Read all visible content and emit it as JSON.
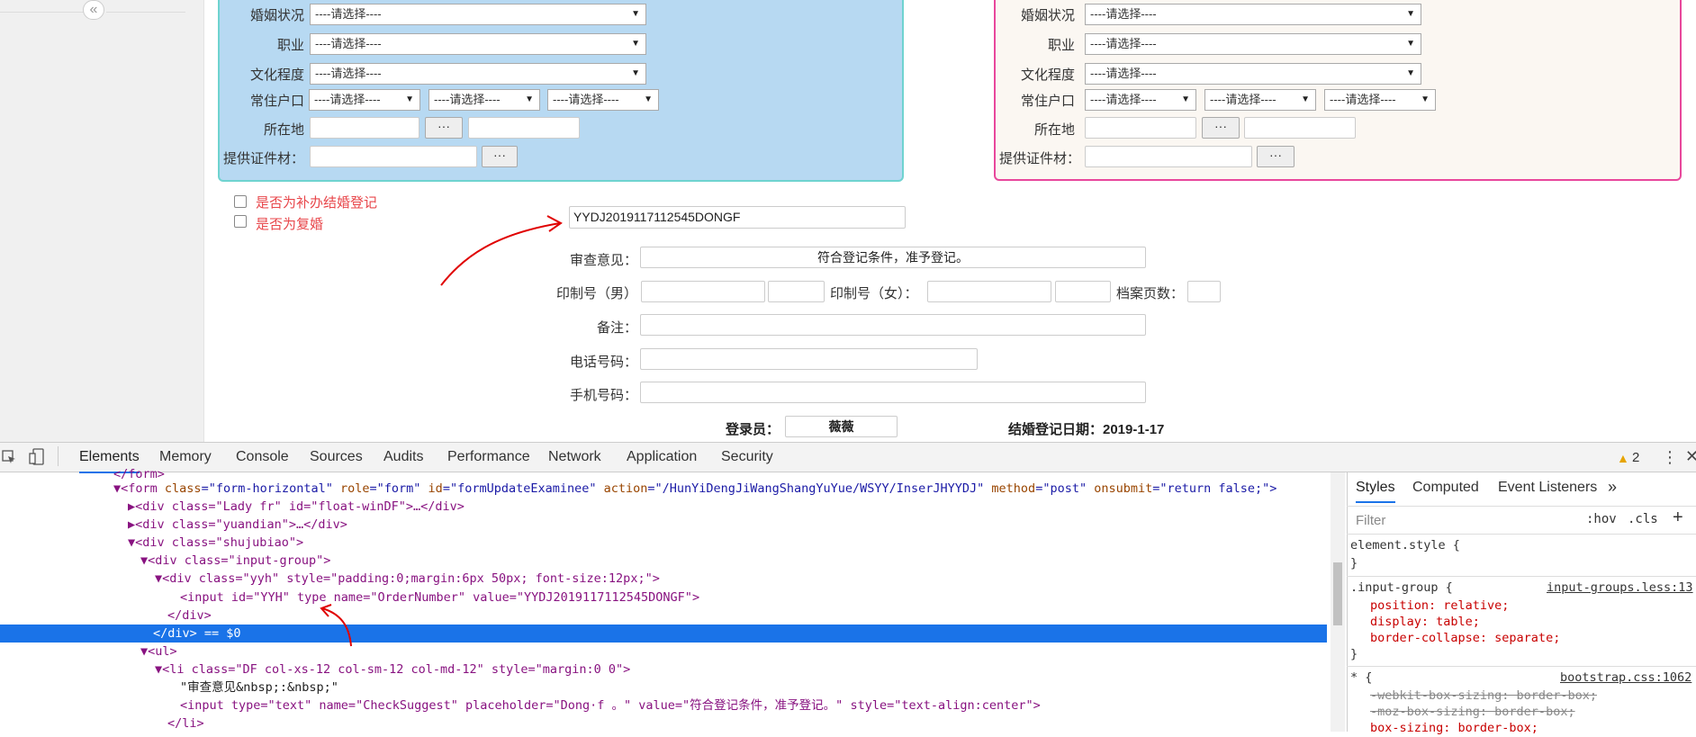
{
  "form": {
    "select_placeholder": "----请选择----",
    "labels": {
      "marital": "婚姻状况",
      "job": "职业",
      "education": "文化程度",
      "residence": "常住户口",
      "location": "所在地",
      "documents": "提供证件材：",
      "review": "审查意见：",
      "print_male": "印制号（男）",
      "print_female": "印制号（女）：",
      "archive_pages": "档案页数：",
      "notes": "备注：",
      "phone": "电话号码：",
      "mobile": "手机号码：",
      "operator": "登录员：",
      "marriage_date": "结婚登记日期：2019-1-17"
    },
    "dots": "···",
    "checkbox_supplement": "是否为补办结婚登记",
    "checkbox_remarry": "是否为复婚",
    "order_number": "YYDJ2019117112545DONGF",
    "review_value": "符合登记条件，准予登记。",
    "operator_value": "薇薇"
  },
  "devtools": {
    "tabs": [
      "Elements",
      "Memory",
      "Console",
      "Sources",
      "Audits",
      "Performance",
      "Network",
      "Application",
      "Security"
    ],
    "warning_count": "2",
    "warning_icon": "warning-icon",
    "dom_lines": {
      "l0": "</form>",
      "l1a": "<form ",
      "l1b": "class",
      "l1c": "=\"form-horizontal\" ",
      "l1d": "role",
      "l1e": "=\"form\" ",
      "l1f": "id",
      "l1g": "=\"formUpdateExaminee\" ",
      "l1h": "action",
      "l1i": "=\"/HunYiDengJiWangShangYuYue/WSYY/InserJHYYDJ\" ",
      "l1j": "method",
      "l1k": "=\"post\" ",
      "l1l": "onsubmit",
      "l1m": "=\"return false;\">",
      "l2": "<div class=\"Lady fr\" id=\"float-winDF\">…</div>",
      "l3": "<div class=\"yuandian\">…</div>",
      "l4": "<div class=\"shujubiao\">",
      "l5": "<div class=\"input-group\">",
      "l6": "<div class=\"yyh\" style=\"padding:0;margin:6px 50px; font-size:12px;\">",
      "l7": "<input id=\"YYH\" type name=\"OrderNumber\" value=\"YYDJ2019117112545DONGF\">",
      "l8": "</div>",
      "l9": "</div> == $0",
      "l10": "<ul>",
      "l11": "<li class=\"DF col-xs-12 col-sm-12 col-md-12\" style=\"margin:0 0\">",
      "l12": "\"审查意见&nbsp;:&nbsp;\"",
      "l13": "<input type=\"text\" name=\"CheckSuggest\" placeholder=\"Dong·f 。\" value=\"符合登记条件，准予登记。\" style=\"text-align:center\">",
      "l14": "</li>"
    },
    "styles": {
      "tabs": [
        "Styles",
        "Computed",
        "Event Listeners",
        "»"
      ],
      "filter_placeholder": "Filter",
      "hov": ":hov",
      "cls": ".cls",
      "plus": "+",
      "element_style": "element.style {",
      "close_brace": "}",
      "rule1_selector": ".input-group {",
      "rule1_source": "input-groups.less:13",
      "rule1_props": [
        "position: relative;",
        "display: table;",
        "border-collapse: separate;"
      ],
      "rule2_selector": "* {",
      "rule2_source": "bootstrap.css:1062",
      "rule2_props": [
        "-webkit-box-sizing: border-box;",
        "-moz-box-sizing: border-box;",
        "box-sizing: border-box;"
      ]
    }
  },
  "colors": {
    "panel_blue": "#b7d9f2",
    "panel_pink_border": "#e8479c",
    "devtools_selection": "#1a73e8",
    "annotation_red": "#e00000"
  }
}
